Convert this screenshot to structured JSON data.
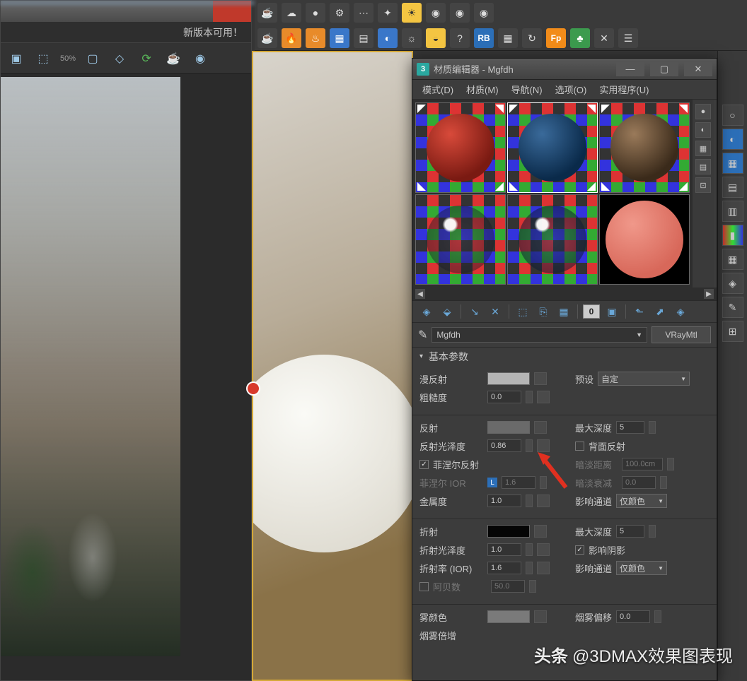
{
  "left_window": {
    "subtitle": "新版本可用！",
    "zoom": "50%"
  },
  "mat_editor": {
    "title": "材质编辑器 - Mgfdh",
    "icon3d": "3",
    "menu": [
      "模式(D)",
      "材质(M)",
      "导航(N)",
      "选项(O)",
      "实用程序(U)"
    ],
    "name": "Mgfdh",
    "type_btn": "VRayMtl",
    "rb_label": "RB",
    "fp_label": "Fp",
    "zero_label": "0",
    "rollout": {
      "title": "基本参数",
      "diffuse_lbl": "漫反射",
      "rough_lbl": "粗糙度",
      "rough_val": "0.0",
      "preset_lbl": "预设",
      "preset_val": "自定",
      "reflect_lbl": "反射",
      "refl_gloss_lbl": "反射光泽度",
      "refl_gloss_val": "0.86",
      "fresnel_lbl": "菲涅尔反射",
      "fresnel_ior_lbl": "菲涅尔 IOR",
      "fresnel_ior_L": "L",
      "fresnel_ior_val": "1.6",
      "metal_lbl": "金属度",
      "metal_val": "1.0",
      "maxdepth_lbl": "最大深度",
      "maxdepth_val": "5",
      "backside_lbl": "背面反射",
      "dimdist_lbl": "暗淡距离",
      "dimdist_val": "100.0cm",
      "dimfall_lbl": "暗淡衰减",
      "dimfall_val": "0.0",
      "affect_lbl": "影响通道",
      "affect_val": "仅颜色",
      "refract_lbl": "折射",
      "refr_gloss_lbl": "折射光泽度",
      "refr_gloss_val": "1.0",
      "ior_lbl": "折射率 (IOR)",
      "ior_val": "1.6",
      "abbe_lbl": "阿贝数",
      "abbe_val": "50.0",
      "refr_maxdepth_lbl": "最大深度",
      "refr_maxdepth_val": "5",
      "affect_shad_lbl": "影响阴影",
      "refr_affect_lbl": "影响通道",
      "refr_affect_val": "仅颜色",
      "fog_lbl": "雾颜色",
      "fogmult_lbl": "烟雾倍增",
      "fogbias_lbl": "烟雾偏移",
      "fogbias_val": "0.0"
    }
  },
  "watermark": {
    "prefix": "头条",
    "text": "@3DMAX效果图表现"
  }
}
